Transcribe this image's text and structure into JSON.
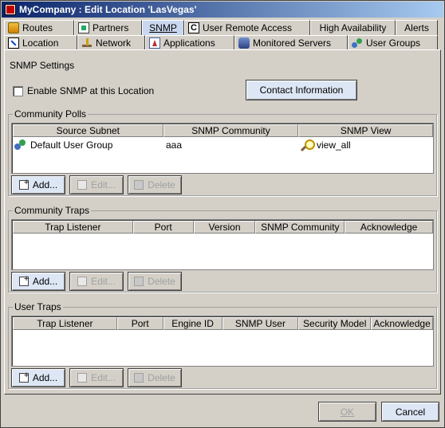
{
  "window": {
    "title": "MyCompany : Edit Location 'LasVegas'"
  },
  "tabs": {
    "row1": [
      {
        "label": "Routes",
        "icon": "routes-icon"
      },
      {
        "label": "Partners",
        "icon": "partners-icon"
      },
      {
        "label": "SNMP",
        "icon": ""
      },
      {
        "label": "User Remote Access",
        "icon": "user-remote-access-icon"
      },
      {
        "label": "High Availability",
        "icon": ""
      },
      {
        "label": "Alerts",
        "icon": ""
      }
    ],
    "row2": [
      {
        "label": "Location",
        "icon": "location-icon"
      },
      {
        "label": "Network",
        "icon": "network-icon"
      },
      {
        "label": "Applications",
        "icon": "applications-icon"
      },
      {
        "label": "Monitored Servers",
        "icon": "monitored-servers-icon"
      },
      {
        "label": "User Groups",
        "icon": "user-groups-icon"
      }
    ],
    "selected": "SNMP"
  },
  "snmp": {
    "section_title": "SNMP Settings",
    "enable_label": "Enable SNMP at this Location",
    "enable_checked": false,
    "contact_button": "Contact Information"
  },
  "community_polls": {
    "title": "Community Polls",
    "columns": [
      "Source Subnet",
      "SNMP Community",
      "SNMP View"
    ],
    "rows": [
      {
        "source_subnet": "Default User Group",
        "snmp_community": "aaa",
        "snmp_view": "view_all"
      }
    ]
  },
  "community_traps": {
    "title": "Community Traps",
    "columns": [
      "Trap Listener",
      "Port",
      "Version",
      "SNMP Community",
      "Acknowledge"
    ]
  },
  "user_traps": {
    "title": "User Traps",
    "columns": [
      "Trap Listener",
      "Port",
      "Engine ID",
      "SNMP User",
      "Security Model",
      "Acknowledge"
    ]
  },
  "buttons": {
    "add": "Add...",
    "edit": "Edit...",
    "delete": "Delete"
  },
  "footer": {
    "ok": "OK",
    "cancel": "Cancel"
  }
}
